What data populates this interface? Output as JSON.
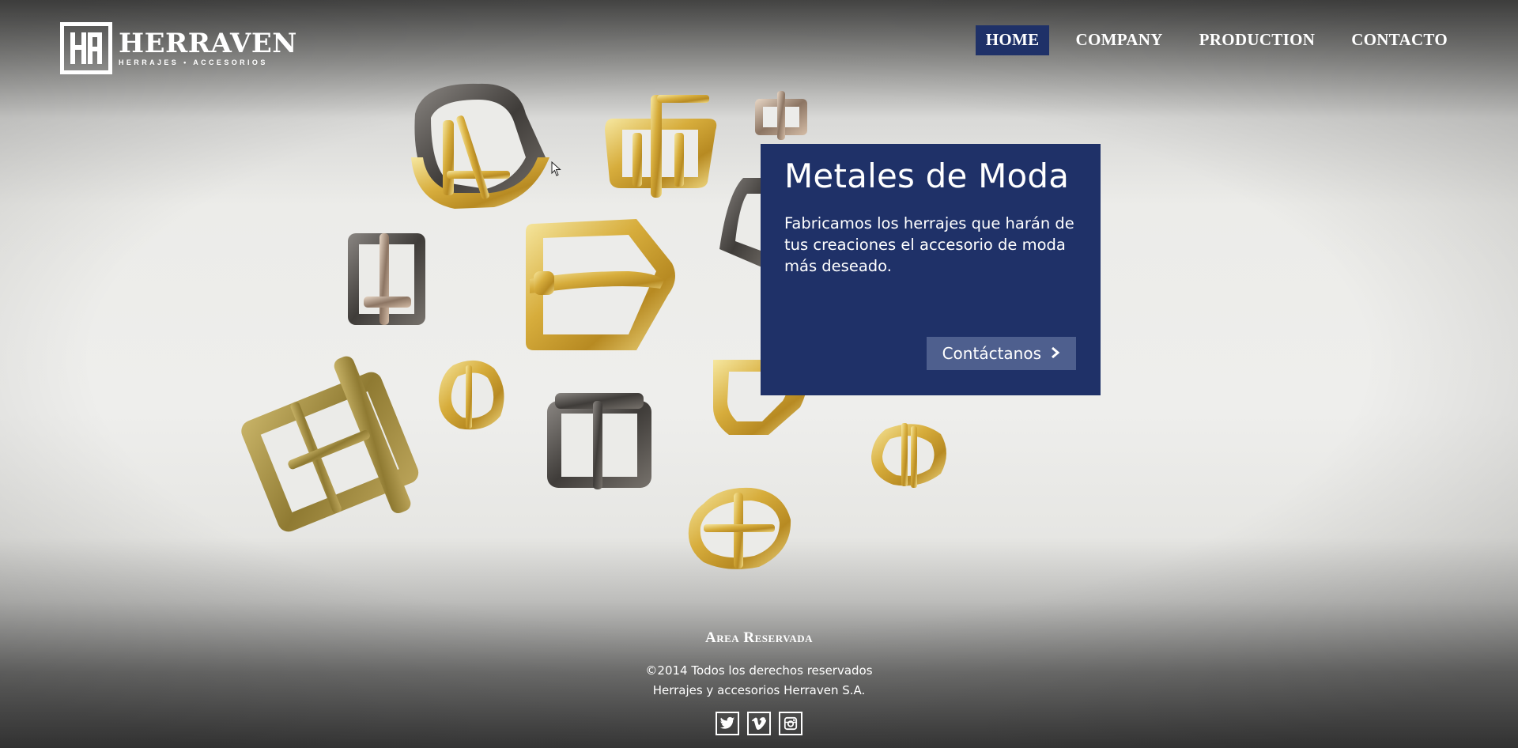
{
  "brand": {
    "name": "HERRAVEN",
    "tagline": "HERRAJES • ACCESORIOS"
  },
  "nav": {
    "items": [
      {
        "label": "HOME",
        "active": true
      },
      {
        "label": "COMPANY",
        "active": false
      },
      {
        "label": "PRODUCTION",
        "active": false
      },
      {
        "label": "CONTACTO",
        "active": false
      }
    ]
  },
  "promo": {
    "title": "Metales de Moda",
    "text": "Fabricamos los herrajes que harán de tus creaciones el accesorio de moda más deseado.",
    "button_label": "Contáctanos"
  },
  "footer": {
    "area_link": "Area Reservada",
    "copyright": "©2014 Todos los derechos reservados",
    "company": "Herrajes y accesorios Herraven S.A.",
    "social": [
      "twitter-icon",
      "vimeo-icon",
      "instagram-icon"
    ]
  },
  "colors": {
    "navy": "#1f3168",
    "button": "#4e5f8e",
    "gold": "#d9b449",
    "brass": "#a08a3a",
    "gunmetal": "#55524d"
  }
}
